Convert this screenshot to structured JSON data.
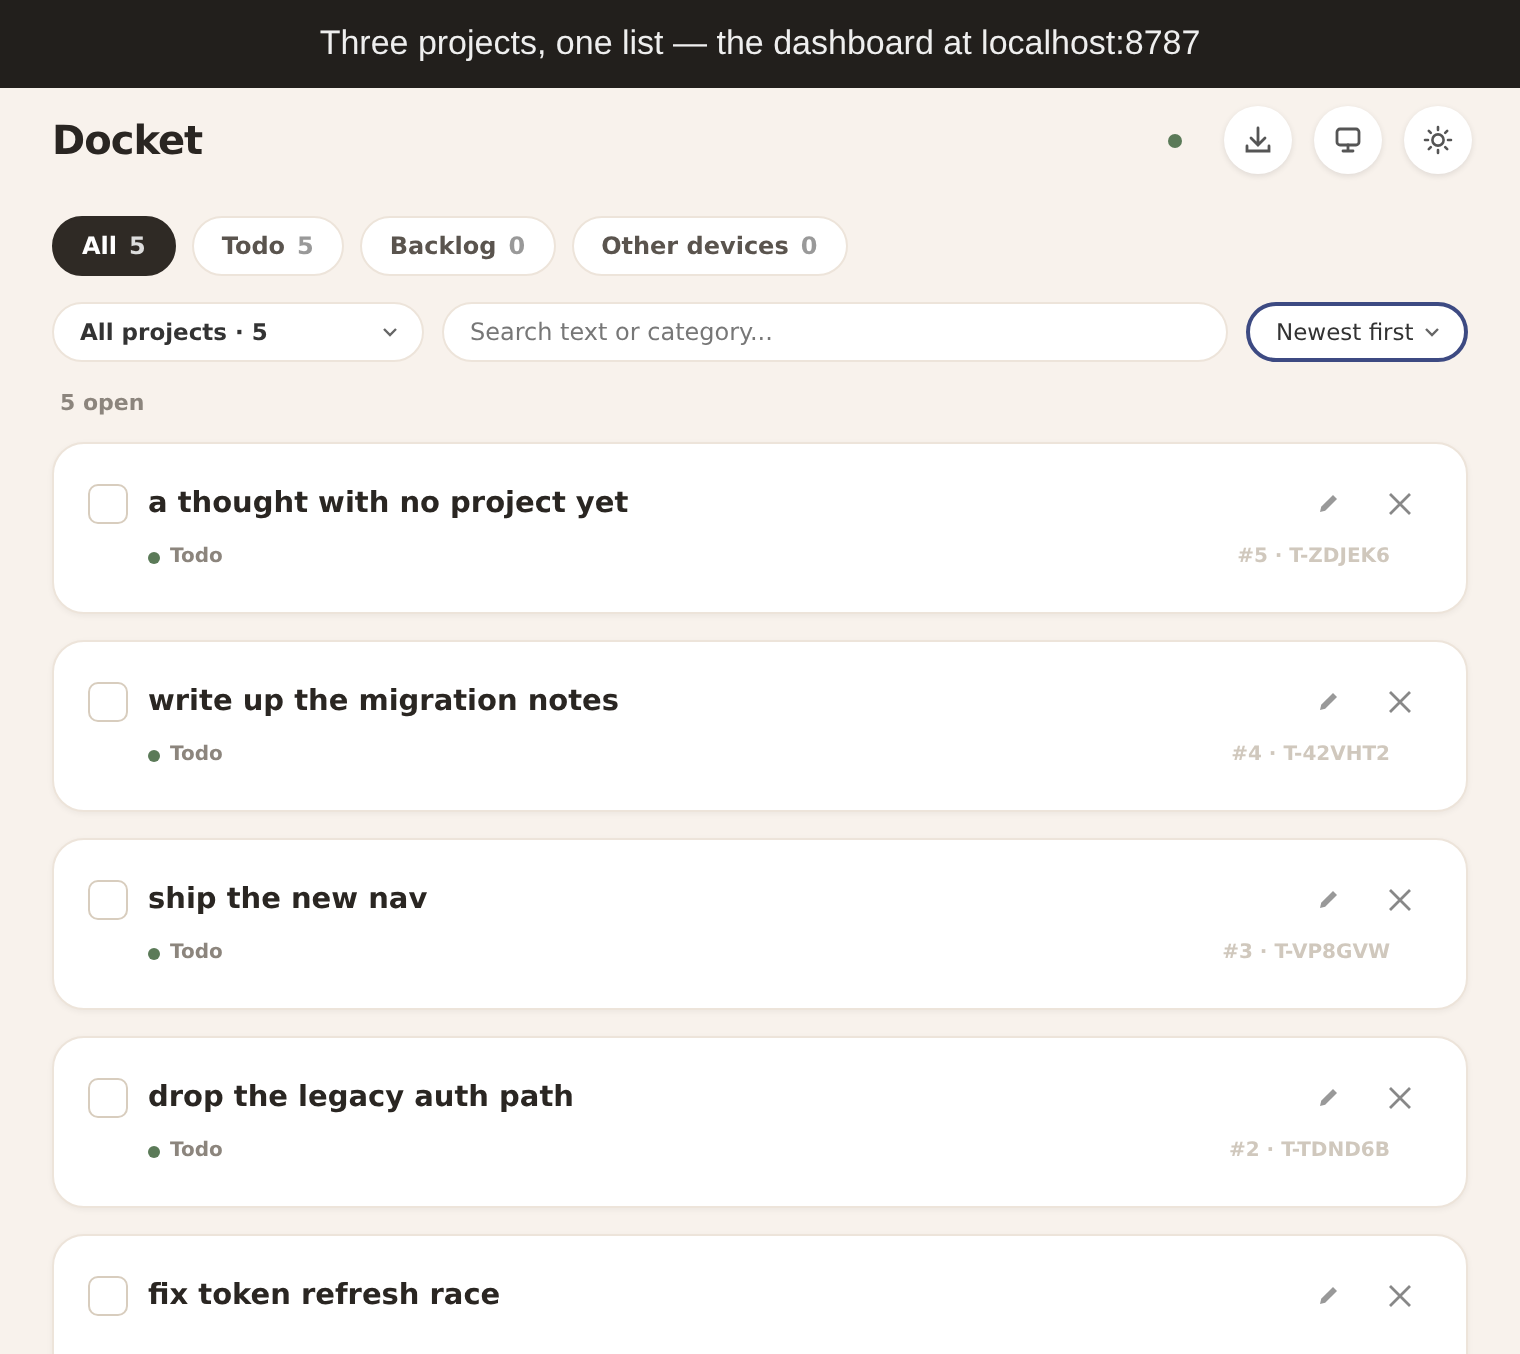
{
  "caption": "Three projects, one list — the dashboard at localhost:8787",
  "app": {
    "title": "Docket",
    "sync_dot": {
      "color": "#5b7a58"
    }
  },
  "tabs": [
    {
      "label": "All",
      "count": "5",
      "selected": true
    },
    {
      "label": "Todo",
      "count": "5",
      "selected": false
    },
    {
      "label": "Backlog",
      "count": "0",
      "selected": false
    },
    {
      "label": "Other devices",
      "count": "0",
      "selected": false
    }
  ],
  "filters": {
    "project": "All projects · 5",
    "search": {
      "placeholder": "Search text or category..."
    },
    "sort": "Newest first"
  },
  "open_count": "5 open",
  "tasks": [
    {
      "title": "a thought with no project yet",
      "checked": false,
      "status": "Todo",
      "color": "#5b7a58",
      "ref": "#5 · T-ZDJEK6"
    },
    {
      "title": "write up the migration notes",
      "checked": false,
      "status": "Todo",
      "color": "#5b7a58",
      "ref": "#4 · T-42VHT2"
    },
    {
      "title": "ship the new nav",
      "checked": false,
      "status": "Todo",
      "color": "#5b7a58",
      "ref": "#3 · T-VP8GVW"
    },
    {
      "title": "drop the legacy auth path",
      "checked": false,
      "status": "Todo",
      "color": "#5b7a58",
      "ref": "#2 · T-TDND6B"
    },
    {
      "title": "fix token refresh race",
      "checked": false
    }
  ]
}
